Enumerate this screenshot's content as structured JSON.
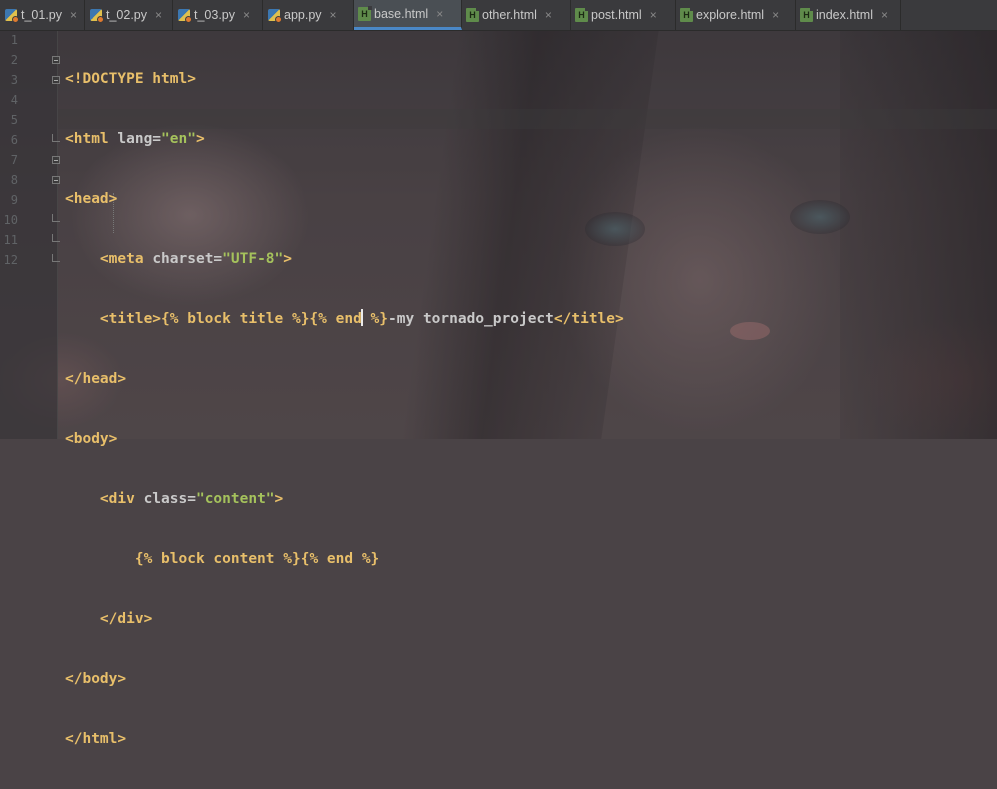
{
  "tabs": [
    {
      "label": "t_01.py",
      "icon": "python-file-icon",
      "active": false
    },
    {
      "label": "t_02.py",
      "icon": "python-file-icon",
      "active": false
    },
    {
      "label": "t_03.py",
      "icon": "python-file-icon",
      "active": false
    },
    {
      "label": "app.py",
      "icon": "python-file-icon",
      "active": false
    },
    {
      "label": "base.html",
      "icon": "html-file-icon",
      "active": true
    },
    {
      "label": "other.html",
      "icon": "html-file-icon",
      "active": false
    },
    {
      "label": "post.html",
      "icon": "html-file-icon",
      "active": false
    },
    {
      "label": "explore.html",
      "icon": "html-file-icon",
      "active": false
    },
    {
      "label": "index.html",
      "icon": "html-file-icon",
      "active": false
    }
  ],
  "close_glyph": "×",
  "html_icon_letter": "H",
  "line_numbers": [
    "1",
    "2",
    "3",
    "4",
    "5",
    "6",
    "7",
    "8",
    "9",
    "10",
    "11",
    "12"
  ],
  "code": {
    "l1": "<!DOCTYPE html>",
    "l2_open": "<html ",
    "l2_attr": "lang=",
    "l2_val": "\"en\"",
    "l2_close": ">",
    "l3": "<head>",
    "l4_indent": "    ",
    "l4_open": "<meta ",
    "l4_attr": "charset=",
    "l4_val": "\"UTF-8\"",
    "l4_close": ">",
    "l5_indent": "    ",
    "l5_open": "<title>",
    "l5_tpl1": "{% block title %}{% end",
    "l5_tpl2": " %}",
    "l5_text": "-my tornado_project",
    "l5_close": "</title>",
    "l6": "</head>",
    "l7": "<body>",
    "l8_indent": "    ",
    "l8_open": "<div ",
    "l8_attr": "class=",
    "l8_val": "\"content\"",
    "l8_close": ">",
    "l9_indent": "        ",
    "l9_tpl": "{% block content %}{% end %}",
    "l10_indent": "    ",
    "l10": "</div>",
    "l11": "</body>",
    "l12": "</html>"
  },
  "colors": {
    "tag": "#e8bf6a",
    "string": "#a5c25c",
    "text": "#c9c9c9",
    "active_tab_underline": "#4a88c7",
    "line_number": "#606366"
  }
}
